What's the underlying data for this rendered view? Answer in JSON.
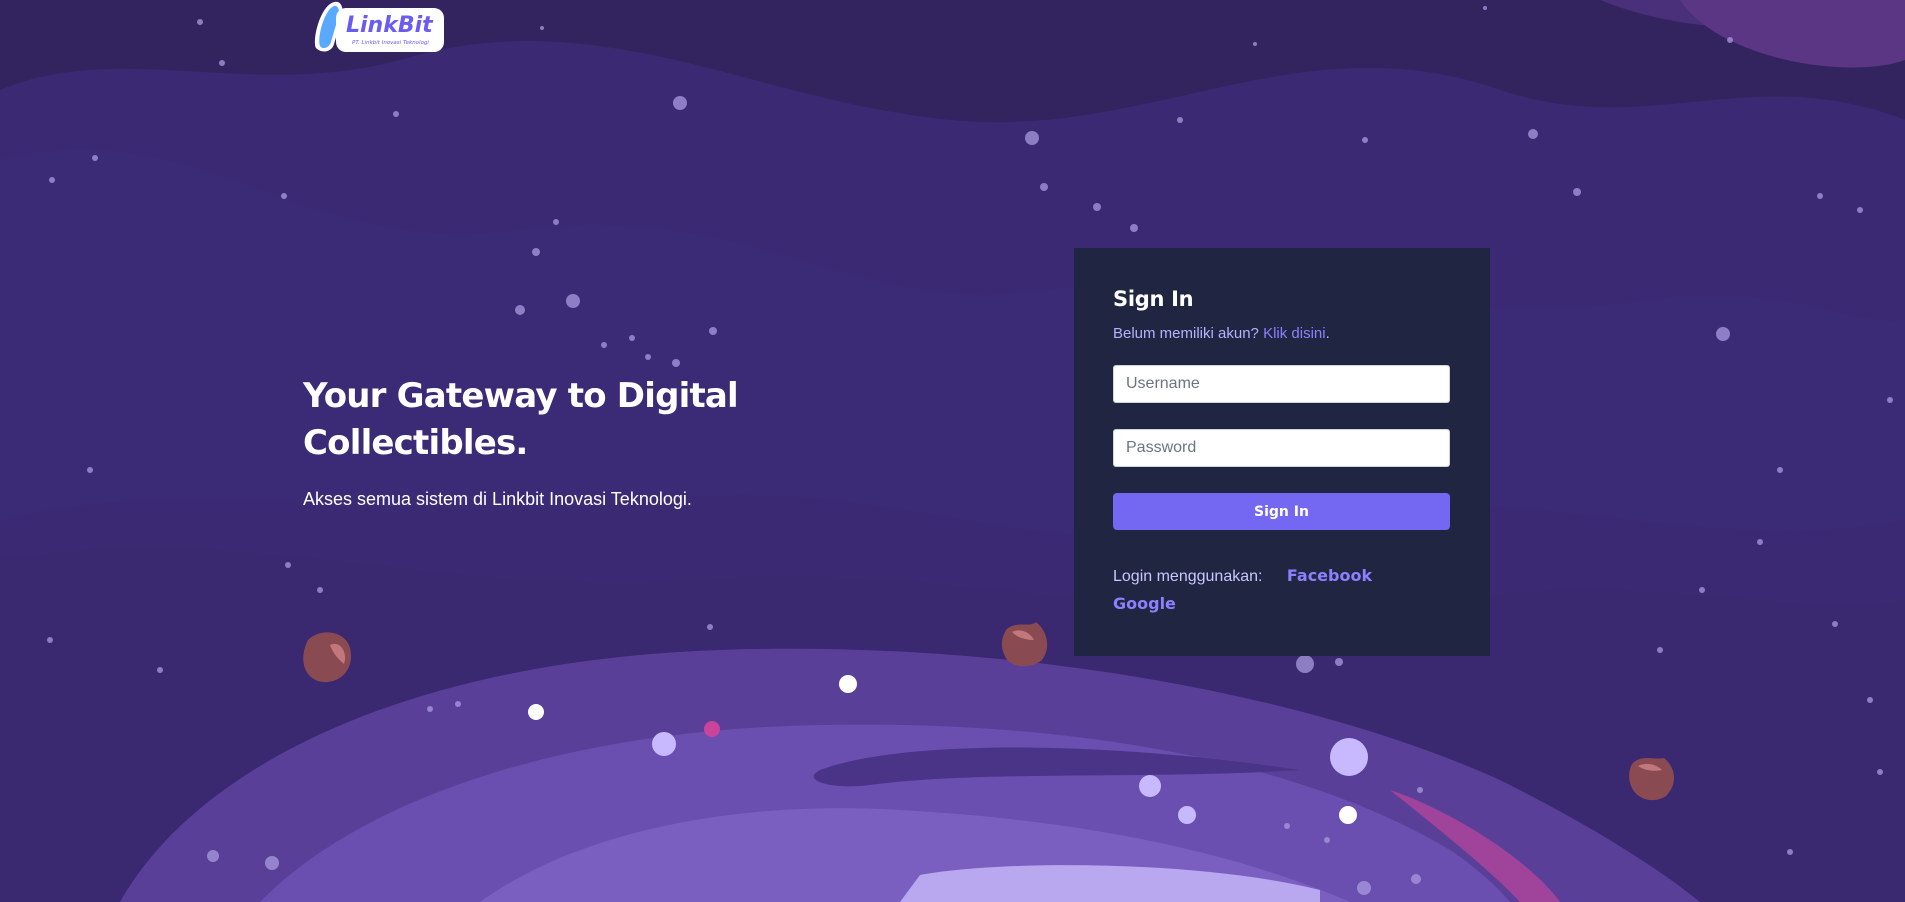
{
  "logo": {
    "name": "LinkBit",
    "tagline": "PT. Linkbit Inovasi Teknologi"
  },
  "hero": {
    "title_line1": "Your Gateway to Digital",
    "title_line2": "Collectibles.",
    "subtitle": "Akses semua sistem di Linkbit Inovasi Teknologi."
  },
  "login": {
    "title": "Sign In",
    "register_prompt": "Belum memiliki akun? ",
    "register_link": "Klik disini",
    "register_end": ".",
    "username_placeholder": "Username",
    "username_value": "",
    "password_placeholder": "Password",
    "password_value": "",
    "submit_label": "Sign In",
    "social_label": "Login menggunakan:",
    "facebook": "Facebook",
    "google": "Google"
  },
  "colors": {
    "background": "#3a2a72",
    "card": "#202541",
    "accent": "#7468f3",
    "link": "#8c80ff"
  }
}
